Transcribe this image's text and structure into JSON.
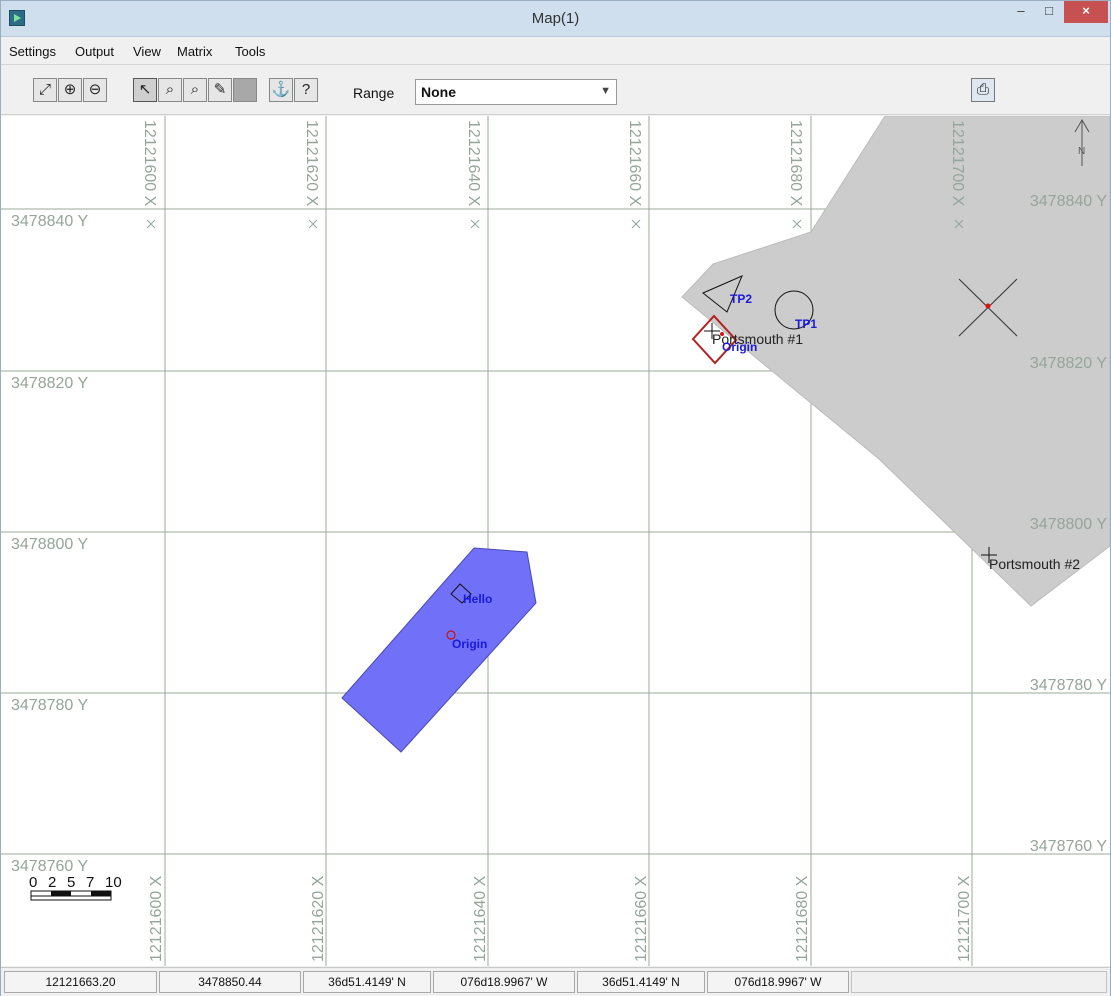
{
  "window": {
    "title": "Map(1)",
    "minimize_glyph": "–",
    "maximize_glyph": "□",
    "close_glyph": "×"
  },
  "menu": [
    "Settings",
    "Output",
    "View",
    "Matrix",
    "Tools"
  ],
  "toolbar": {
    "groups": [
      [
        "zoom-extents-icon",
        "zoom-in-icon",
        "zoom-out-icon"
      ],
      [
        "select-arrow-icon",
        "zoom-window-icon",
        "zoom-dynamic-icon",
        "edit-pencil-icon",
        "blank-tool-icon"
      ],
      [
        "anchor-icon",
        "pointer-info-icon"
      ]
    ],
    "range_label": "Range",
    "range_value": "None",
    "print_icon": "printer-icon"
  },
  "map": {
    "north_arrow": "N",
    "x_grid_labels": [
      "12121600 X",
      "12121620 X",
      "12121640 X",
      "12121660 X",
      "12121680 X",
      "12121700 X"
    ],
    "y_grid_labels_left": [
      "3478840 Y",
      "3478820 Y",
      "3478800 Y",
      "3478780 Y",
      "3478760 Y"
    ],
    "y_grid_labels_right": [
      "3478840 Y",
      "3478820 Y",
      "3478800 Y",
      "3478780 Y",
      "3478760 Y"
    ],
    "scale_labels": [
      "0",
      "2",
      "5",
      "7",
      "10"
    ],
    "feature_labels": {
      "tp1": "TP1",
      "tp2": "TP2",
      "origin_top": "Origin",
      "portsmouth1": "Portsmouth #1",
      "portsmouth2": "Portsmouth #2",
      "hello": "Hello",
      "origin_bottom": "Origin"
    },
    "colors": {
      "grid": "#9aa89a",
      "label": "#95a59a",
      "land_area": "#cccccc",
      "vessel_fill": "#7070f8",
      "feature_label": "#1a1ad8",
      "marker_red": "#e01010",
      "origin_box": "#b42020"
    }
  },
  "status": [
    "12121663.20",
    "3478850.44",
    "36d51.4149' N",
    "076d18.9967' W",
    "36d51.4149' N",
    "076d18.9967' W"
  ]
}
